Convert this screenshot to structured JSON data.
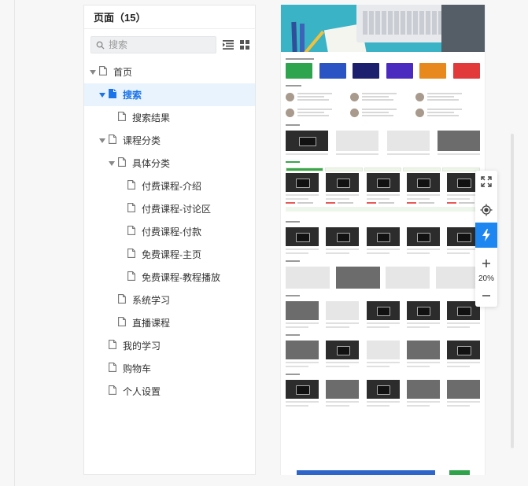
{
  "panel": {
    "title": "页面（15）",
    "search_placeholder": "搜索"
  },
  "tree": [
    {
      "label": "首页",
      "level": 0,
      "expanded": true,
      "active": false
    },
    {
      "label": "搜索",
      "level": 1,
      "expanded": true,
      "active": true
    },
    {
      "label": "搜索结果",
      "level": 2,
      "expanded": false,
      "active": false
    },
    {
      "label": "课程分类",
      "level": 1,
      "expanded": true,
      "active": false
    },
    {
      "label": "具体分类",
      "level": 2,
      "expanded": true,
      "active": false
    },
    {
      "label": "付费课程-介绍",
      "level": 3,
      "expanded": false,
      "active": false
    },
    {
      "label": "付费课程-讨论区",
      "level": 3,
      "expanded": false,
      "active": false
    },
    {
      "label": "付费课程-付款",
      "level": 3,
      "expanded": false,
      "active": false
    },
    {
      "label": "免费课程-主页",
      "level": 3,
      "expanded": false,
      "active": false
    },
    {
      "label": "免费课程-教程播放",
      "level": 3,
      "expanded": false,
      "active": false
    },
    {
      "label": "系统学习",
      "level": 2,
      "expanded": false,
      "active": false
    },
    {
      "label": "直播课程",
      "level": 2,
      "expanded": false,
      "active": false
    },
    {
      "label": "我的学习",
      "level": 1,
      "expanded": false,
      "active": false
    },
    {
      "label": "购物车",
      "level": 1,
      "expanded": false,
      "active": false
    },
    {
      "label": "个人设置",
      "level": 1,
      "expanded": false,
      "active": false
    }
  ],
  "zoom": {
    "value": "20%",
    "icons": [
      "fit-screen-icon",
      "locate-icon",
      "lightning-icon",
      "zoom-in-icon",
      "zoom-out-icon"
    ]
  },
  "colors": {
    "accent": "#1e86f0",
    "active_bg": "#e9f3fd",
    "active_text": "#1a73e8",
    "category_tiles": [
      "#2ea44f",
      "#2a53c4",
      "#1c1f6e",
      "#4b2bbf",
      "#e7891c",
      "#e23a3a"
    ]
  }
}
